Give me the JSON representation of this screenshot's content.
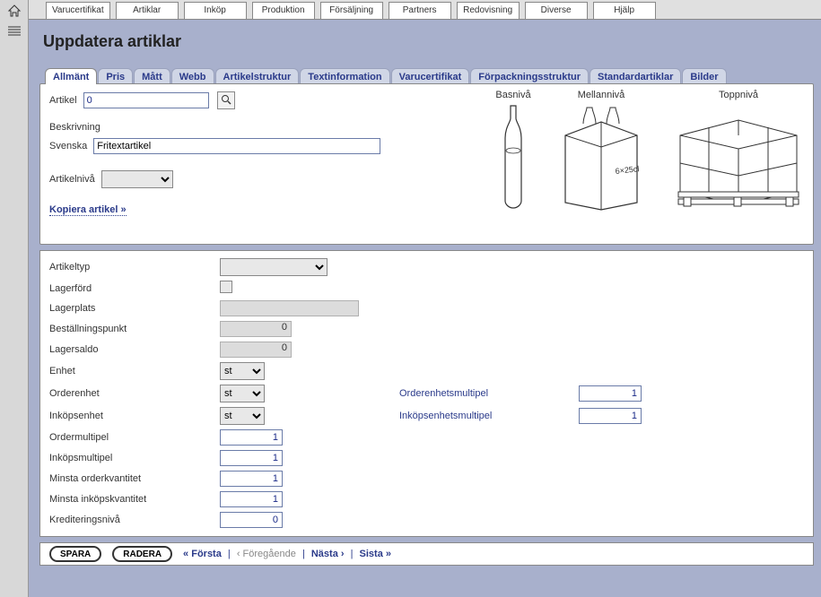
{
  "menu": [
    "Varucertifikat",
    "Artiklar",
    "Inköp",
    "Produktion",
    "Försäljning",
    "Partners",
    "Redovisning",
    "Diverse",
    "Hjälp"
  ],
  "page": {
    "title": "Uppdatera artiklar"
  },
  "tabs": [
    "Allmänt",
    "Pris",
    "Mått",
    "Webb",
    "Artikelstruktur",
    "Textinformation",
    "Varucertifikat",
    "Förpackningsstruktur",
    "Standardartiklar",
    "Bilder"
  ],
  "top": {
    "artikel_label": "Artikel",
    "artikel_value": "0",
    "beskrivning_label": "Beskrivning",
    "svenska_label": "Svenska",
    "svenska_value": "Fritextartikel",
    "artikelniva_label": "Artikelnivå",
    "copy_link": "Kopiera artikel »",
    "levels": {
      "bas": "Basnivå",
      "mellan": "Mellannivå",
      "topp": "Toppnivå"
    }
  },
  "form": {
    "artikeltyp": {
      "label": "Artikeltyp",
      "value": ""
    },
    "lagerford": {
      "label": "Lagerförd",
      "checked": false
    },
    "lagerplats": {
      "label": "Lagerplats",
      "value": ""
    },
    "bestallningspunkt": {
      "label": "Beställningspunkt",
      "value": "0"
    },
    "lagersaldo": {
      "label": "Lagersaldo",
      "value": "0"
    },
    "enhet": {
      "label": "Enhet",
      "value": "st"
    },
    "orderenhet": {
      "label": "Orderenhet",
      "value": "st"
    },
    "orderenhetsmultipel": {
      "label": "Orderenhetsmultipel",
      "value": "1"
    },
    "inkopsenhet": {
      "label": "Inköpsenhet",
      "value": "st"
    },
    "inkopsenhetsmultipel": {
      "label": "Inköpsenhetsmultipel",
      "value": "1"
    },
    "ordermultipel": {
      "label": "Ordermultipel",
      "value": "1"
    },
    "inkopsmultipel": {
      "label": "Inköpsmultipel",
      "value": "1"
    },
    "minsta_orderkvantitet": {
      "label": "Minsta orderkvantitet",
      "value": "1"
    },
    "minsta_inkopskvantitet": {
      "label": "Minsta inköpskvantitet",
      "value": "1"
    },
    "krediteringsniva": {
      "label": "Krediteringsnivå",
      "value": "0"
    }
  },
  "footer": {
    "save": "SPARA",
    "delete": "RADERA",
    "first": "« Första",
    "prev": "‹ Föregående",
    "next": "Nästa ›",
    "last": "Sista »"
  }
}
